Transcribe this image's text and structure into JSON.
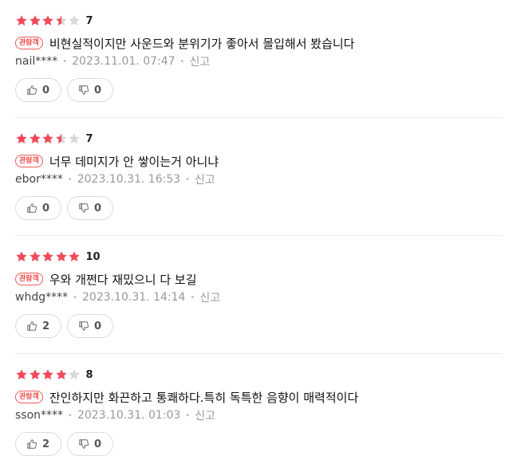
{
  "colors": {
    "star_filled": "#ef4a5a",
    "star_empty": "#d9d9d9",
    "badge": "#ef4a4a"
  },
  "reviews": [
    {
      "stars": 3.5,
      "score": "7",
      "badge": "관람객",
      "text": "비현실적이지만 사운드와 분위기가 좋아서 몰입해서 봤습니다",
      "user": "nail****",
      "date": "2023.11.01. 07:47",
      "report": "신고",
      "likes": "0",
      "dislikes": "0"
    },
    {
      "stars": 3.5,
      "score": "7",
      "badge": "관람객",
      "text": "너무 데미지가 안 쌓이는거 아니냐",
      "user": "ebor****",
      "date": "2023.10.31. 16:53",
      "report": "신고",
      "likes": "0",
      "dislikes": "0"
    },
    {
      "stars": 5,
      "score": "10",
      "badge": "관람객",
      "text": "우와 개쩐다 재밌으니 다 보길",
      "user": "whdg****",
      "date": "2023.10.31. 14:14",
      "report": "신고",
      "likes": "2",
      "dislikes": "0"
    },
    {
      "stars": 4,
      "score": "8",
      "badge": "관람객",
      "text": "잔인하지만 화끈하고 통쾌하다.특히 독특한 음향이 매력적이다",
      "user": "sson****",
      "date": "2023.10.31. 01:03",
      "report": "신고",
      "likes": "2",
      "dislikes": "0"
    }
  ]
}
